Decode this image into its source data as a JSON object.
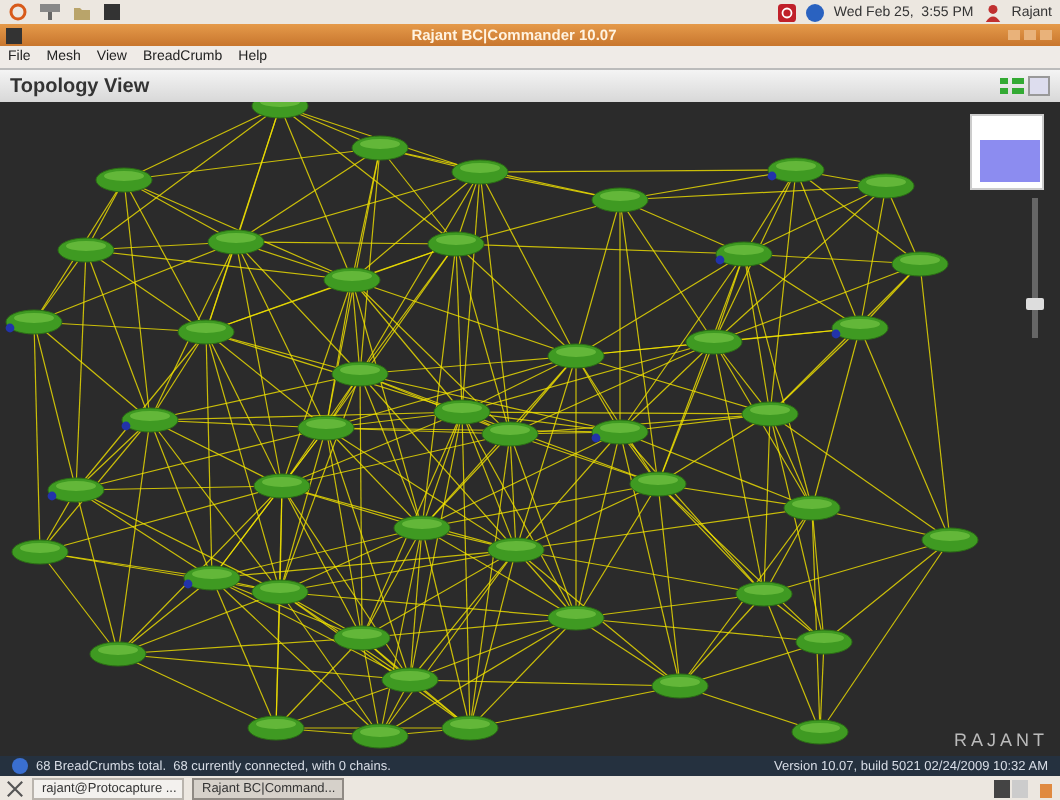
{
  "top_panel": {
    "clock": "Wed Feb 25,  3:55 PM",
    "user": "Rajant"
  },
  "window": {
    "title": "Rajant BC|Commander 10.07"
  },
  "menu": [
    "File",
    "Mesh",
    "View",
    "BreadCrumb",
    "Help"
  ],
  "view": {
    "title": "Topology View",
    "zoom_slider": {
      "level": 0.2
    },
    "logo": "RAJANT"
  },
  "status_bar": {
    "summary": "68 BreadCrumbs total.  68 currently connected, with 0 chains.",
    "version": "Version 10.07, build 5021 02/24/2009 10:32 AM"
  },
  "taskbar": {
    "windows": [
      {
        "label": "rajant@Protocapture ...",
        "selected": false
      },
      {
        "label": "Rajant BC|Command...",
        "selected": true
      }
    ]
  }
}
